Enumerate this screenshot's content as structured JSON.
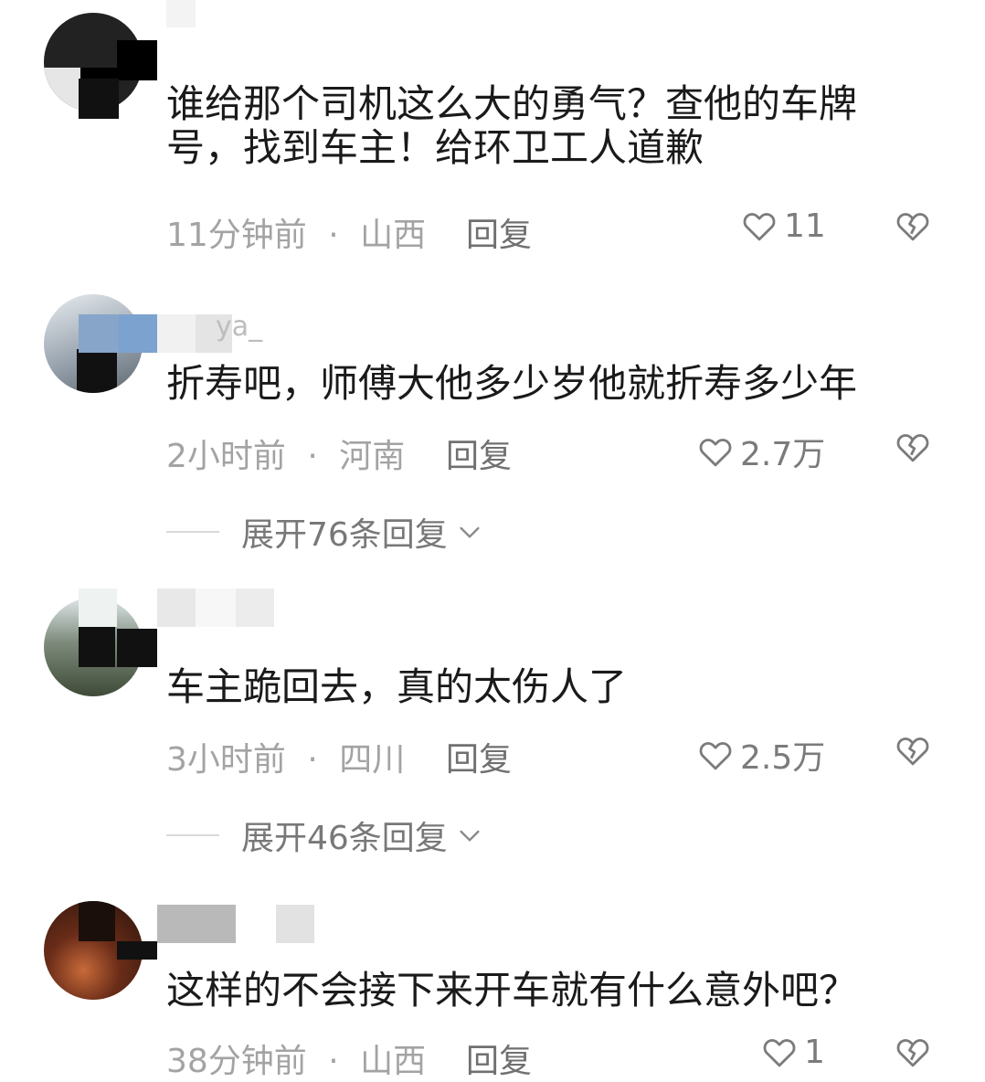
{
  "comments": [
    {
      "username": "",
      "text": "谁给那个司机这么大的勇气？查他的车牌号，找到车主！给环卫工人道歉",
      "time": "11分钟前",
      "location": "山西",
      "reply_label": "回复",
      "likes": "11"
    },
    {
      "username": "ya_",
      "text": "折寿吧，师傅大他多少岁他就折寿多少年",
      "time": "2小时前",
      "location": "河南",
      "reply_label": "回复",
      "likes": "2.7万",
      "expand_label": "展开76条回复"
    },
    {
      "username": "",
      "text": "车主跪回去，真的太伤人了",
      "time": "3小时前",
      "location": "四川",
      "reply_label": "回复",
      "likes": "2.5万",
      "expand_label": "展开46条回复"
    },
    {
      "username": "",
      "text": "这样的不会接下来开车就有什么意外吧？",
      "time": "38分钟前",
      "location": "山西",
      "reply_label": "回复",
      "likes": "1"
    }
  ],
  "separator": "·",
  "icons": {
    "like": "heart-outline-icon",
    "dislike": "broken-heart-icon",
    "expand": "chevron-down-icon"
  },
  "colors": {
    "text": "#1a1a1a",
    "meta": "#a3a3a3",
    "action": "#707070"
  }
}
